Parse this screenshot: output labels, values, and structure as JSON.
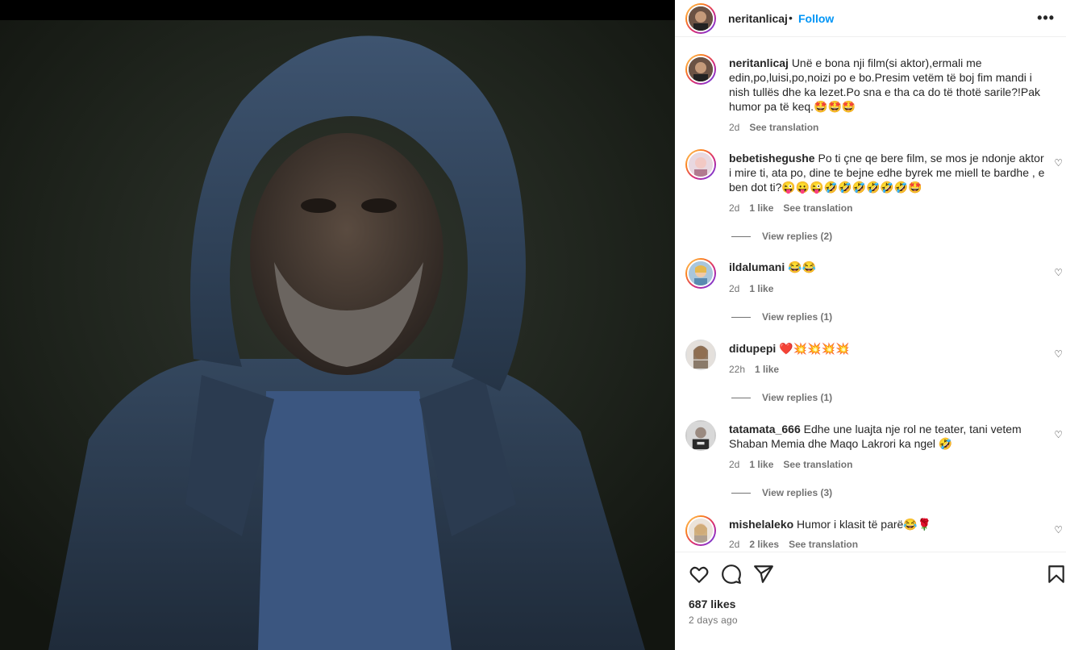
{
  "header": {
    "username": "neritanlicaj",
    "separator": "•",
    "follow_label": "Follow",
    "more_label": "•••"
  },
  "caption": {
    "username": "neritanlicaj",
    "text": "Unë e bona nji film(si aktor),ermali me edin,po,luisi,po,noizi po e bo.Presim vetëm të boj fim mandi i nish tullës dhe ka lezet.Po sna e tha ca do të thotë sarile?!Pak humor pa të keq.🤩🤩🤩",
    "time": "2d",
    "translation": "See translation"
  },
  "comments": [
    {
      "username": "bebetishegushe",
      "text": "Po ti çne qe bere film, se mos je ndonje aktor i mire ti, ata po, dine te bejne edhe byrek me miell te bardhe , e ben dot ti?😜😛😜🤣🤣🤣🤣🤣🤣🤩",
      "time": "2d",
      "likes": "1 like",
      "translation": "See translation",
      "replies": "View replies (2)"
    },
    {
      "username": "ildalumani",
      "text": "😂😂",
      "time": "2d",
      "likes": "1 like",
      "translation": "",
      "replies": "View replies (1)"
    },
    {
      "username": "didupepi",
      "text": "❤️💥💥💥💥",
      "time": "22h",
      "likes": "1 like",
      "translation": "",
      "replies": "View replies (1)"
    },
    {
      "username": "tatamata_666",
      "text": "Edhe une luajta nje rol ne teater, tani vetem Shaban Memia dhe Maqo Lakrori ka ngel 🤣",
      "time": "2d",
      "likes": "1 like",
      "translation": "See translation",
      "replies": "View replies (3)"
    },
    {
      "username": "mishelaleko",
      "text": "Humor i klasit të parë😂🌹",
      "time": "2d",
      "likes": "2 likes",
      "translation": "See translation",
      "replies": ""
    }
  ],
  "footer": {
    "likes": "687 likes",
    "ago": "2 days ago"
  },
  "icons": [
    "heart-icon",
    "comment-icon",
    "share-icon",
    "bookmark-icon",
    "more-icon"
  ],
  "colors": {
    "accent": "#0095f6",
    "text": "#262626",
    "muted": "#737373"
  }
}
